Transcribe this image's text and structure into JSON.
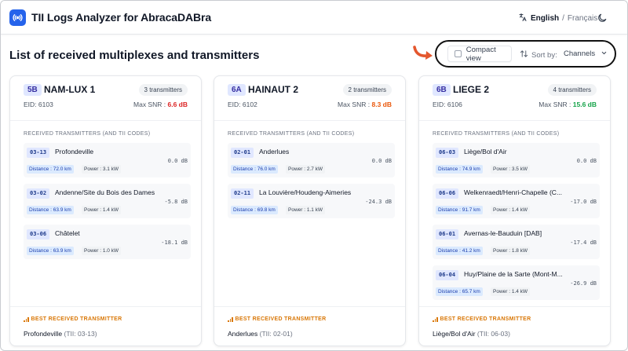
{
  "app": {
    "title": "TII Logs Analyzer for AbracaDABra",
    "language_active": "English",
    "language_separator": "/",
    "language_other": "Français",
    "icons": {
      "logo": "broadcast-icon",
      "translate": "translate-icon",
      "theme": "moon-icon"
    }
  },
  "page": {
    "title": "List of received multiplexes and transmitters",
    "compact_view_label": "Compact view",
    "compact_view_checked": false,
    "sort_by_label": "Sort by:",
    "sort_value": "Channels"
  },
  "labels": {
    "section_title": "RECEIVED TRANSMITTERS (AND TII CODES)",
    "best_title": "BEST RECEIVED TRANSMITTER",
    "eid_prefix": "EID:",
    "snr_prefix": "Max SNR :"
  },
  "colors": {
    "accent": "#2563eb",
    "snr_red": "#dc2626",
    "snr_orange": "#ea580c",
    "snr_green": "#16a34a",
    "best_label": "#d97706"
  },
  "multiplexes": [
    {
      "channel": "5B",
      "name": "NAM-LUX 1",
      "tx_count": "3 transmitters",
      "eid": "6103",
      "max_snr": "6.6 dB",
      "snr_color": "red",
      "transmitters": [
        {
          "tii": "03-13",
          "name": "Profondeville",
          "db": "0.0 dB",
          "distance": "Distance : 72.0 km",
          "power": "Power : 3.1 kW"
        },
        {
          "tii": "03-02",
          "name": "Andenne/Site du Bois des Dames",
          "db": "-5.8 dB",
          "distance": "Distance : 63.9 km",
          "power": "Power : 1.4 kW"
        },
        {
          "tii": "03-06",
          "name": "Châtelet",
          "db": "-18.1 dB",
          "distance": "Distance : 63.9 km",
          "power": "Power : 1.0 kW"
        }
      ],
      "best": {
        "name": "Profondeville",
        "tii": "(TII: 03-13)"
      }
    },
    {
      "channel": "6A",
      "name": "HAINAUT 2",
      "tx_count": "2 transmitters",
      "eid": "6102",
      "max_snr": "8.3 dB",
      "snr_color": "orange",
      "transmitters": [
        {
          "tii": "02-01",
          "name": "Anderlues",
          "db": "0.0 dB",
          "distance": "Distance : 76.0 km",
          "power": "Power : 2.7 kW"
        },
        {
          "tii": "02-11",
          "name": "La Louvière/Houdeng-Aimeries",
          "db": "-24.3 dB",
          "distance": "Distance : 69.8 km",
          "power": "Power : 1.1 kW"
        }
      ],
      "best": {
        "name": "Anderlues",
        "tii": "(TII: 02-01)"
      }
    },
    {
      "channel": "6B",
      "name": "LIEGE 2",
      "tx_count": "4 transmitters",
      "eid": "6106",
      "max_snr": "15.6 dB",
      "snr_color": "green",
      "transmitters": [
        {
          "tii": "06-03",
          "name": "Liège/Bol d'Air",
          "db": "0.0 dB",
          "distance": "Distance : 74.9 km",
          "power": "Power : 3.5 kW"
        },
        {
          "tii": "06-06",
          "name": "Welkenraedt/Henri-Chapelle (C...",
          "db": "-17.0 dB",
          "distance": "Distance : 91.7 km",
          "power": "Power : 1.4 kW"
        },
        {
          "tii": "06-01",
          "name": "Avernas-le-Bauduin [DAB]",
          "db": "-17.4 dB",
          "distance": "Distance : 41.2 km",
          "power": "Power : 1.8 kW"
        },
        {
          "tii": "06-04",
          "name": "Huy/Plaine de la Sarte (Mont-M...",
          "db": "-26.9 dB",
          "distance": "Distance : 65.7 km",
          "power": "Power : 1.4 kW"
        }
      ],
      "best": {
        "name": "Liège/Bol d'Air",
        "tii": "(TII: 06-03)"
      }
    }
  ]
}
